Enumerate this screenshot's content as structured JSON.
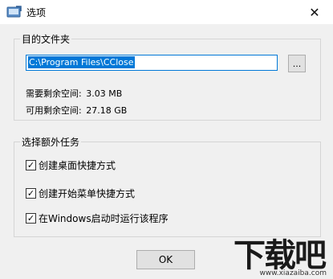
{
  "window": {
    "title": "选项",
    "close_glyph": "✕"
  },
  "target_group": {
    "title": "目的文件夹",
    "path_value": "C:\\Program Files\\CClose",
    "browse_label": "...",
    "required_label": "需要剩余空间:",
    "required_value": "3.03 MB",
    "available_label": "可用剩余空间:",
    "available_value": "27.18 GB"
  },
  "extra_tasks": {
    "title": "选择额外任务",
    "options": [
      {
        "label": "创建桌面快捷方式",
        "checked": true
      },
      {
        "label": "创建开始菜单快捷方式",
        "checked": true
      },
      {
        "label": "在Windows启动时运行该程序",
        "checked": true
      }
    ]
  },
  "footer": {
    "ok_label": "OK"
  },
  "watermark": {
    "brand": "下载吧",
    "url": "www.xiazaiba.com"
  },
  "colors": {
    "accent": "#0078d7",
    "background": "#f0f0f0"
  }
}
